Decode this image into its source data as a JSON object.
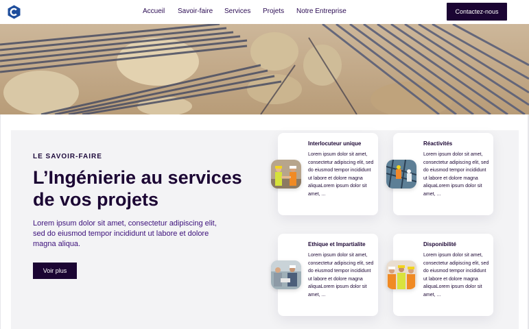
{
  "header": {
    "nav": [
      "Accueil",
      "Savoir-faire",
      "Services",
      "Projets",
      "Notre Entreprise"
    ],
    "cta_label": "Contactez-nous"
  },
  "intro": {
    "eyebrow": "LE SAVOIR-FAIRE",
    "title": "L’Ingénierie au services de vos projets",
    "lead": "Lorem ipsum dolor sit amet, consectetur adipiscing elit, sed do eiusmod tempor incididunt ut labore et dolore magna aliqua.",
    "button_label": "Voir plus"
  },
  "cards": [
    {
      "title": "Interlocuteur unique",
      "body": "Lorem ipsum dolor sit amet, consectetur adipiscing elit, sed do eiusmod tempor incididunt ut labore et dolore magna aliquaLorem ipsum dolor sit amet, ...",
      "icon": "workers-handshake-photo"
    },
    {
      "title": "Réactivités",
      "body": "Lorem ipsum dolor sit amet, consectetur adipiscing elit, sed do eiusmod tempor incididunt ut labore et dolore magna aliquaLorem ipsum dolor sit amet, ...",
      "icon": "workers-site-photo"
    },
    {
      "title": "Ethique et Impartialite",
      "body": "Lorem ipsum dolor sit amet, consectetur adipiscing elit, sed do eiusmod tempor incididunt ut labore et dolore magna aliquaLorem ipsum dolor sit amet, ...",
      "icon": "engineers-meeting-photo"
    },
    {
      "title": "Disponibilité",
      "body": "Lorem ipsum dolor sit amet, consectetur adipiscing elit, sed do eiusmod tempor incididunt ut labore et dolore magna aliquaLorem ipsum dolor sit amet, ...",
      "icon": "workers-helmets-photo"
    }
  ],
  "colors": {
    "brand_dark": "#1b0533",
    "text_purple": "#3b0f7a",
    "logo_blue": "#1f4e9c",
    "section_bg": "#f3f3f5"
  }
}
